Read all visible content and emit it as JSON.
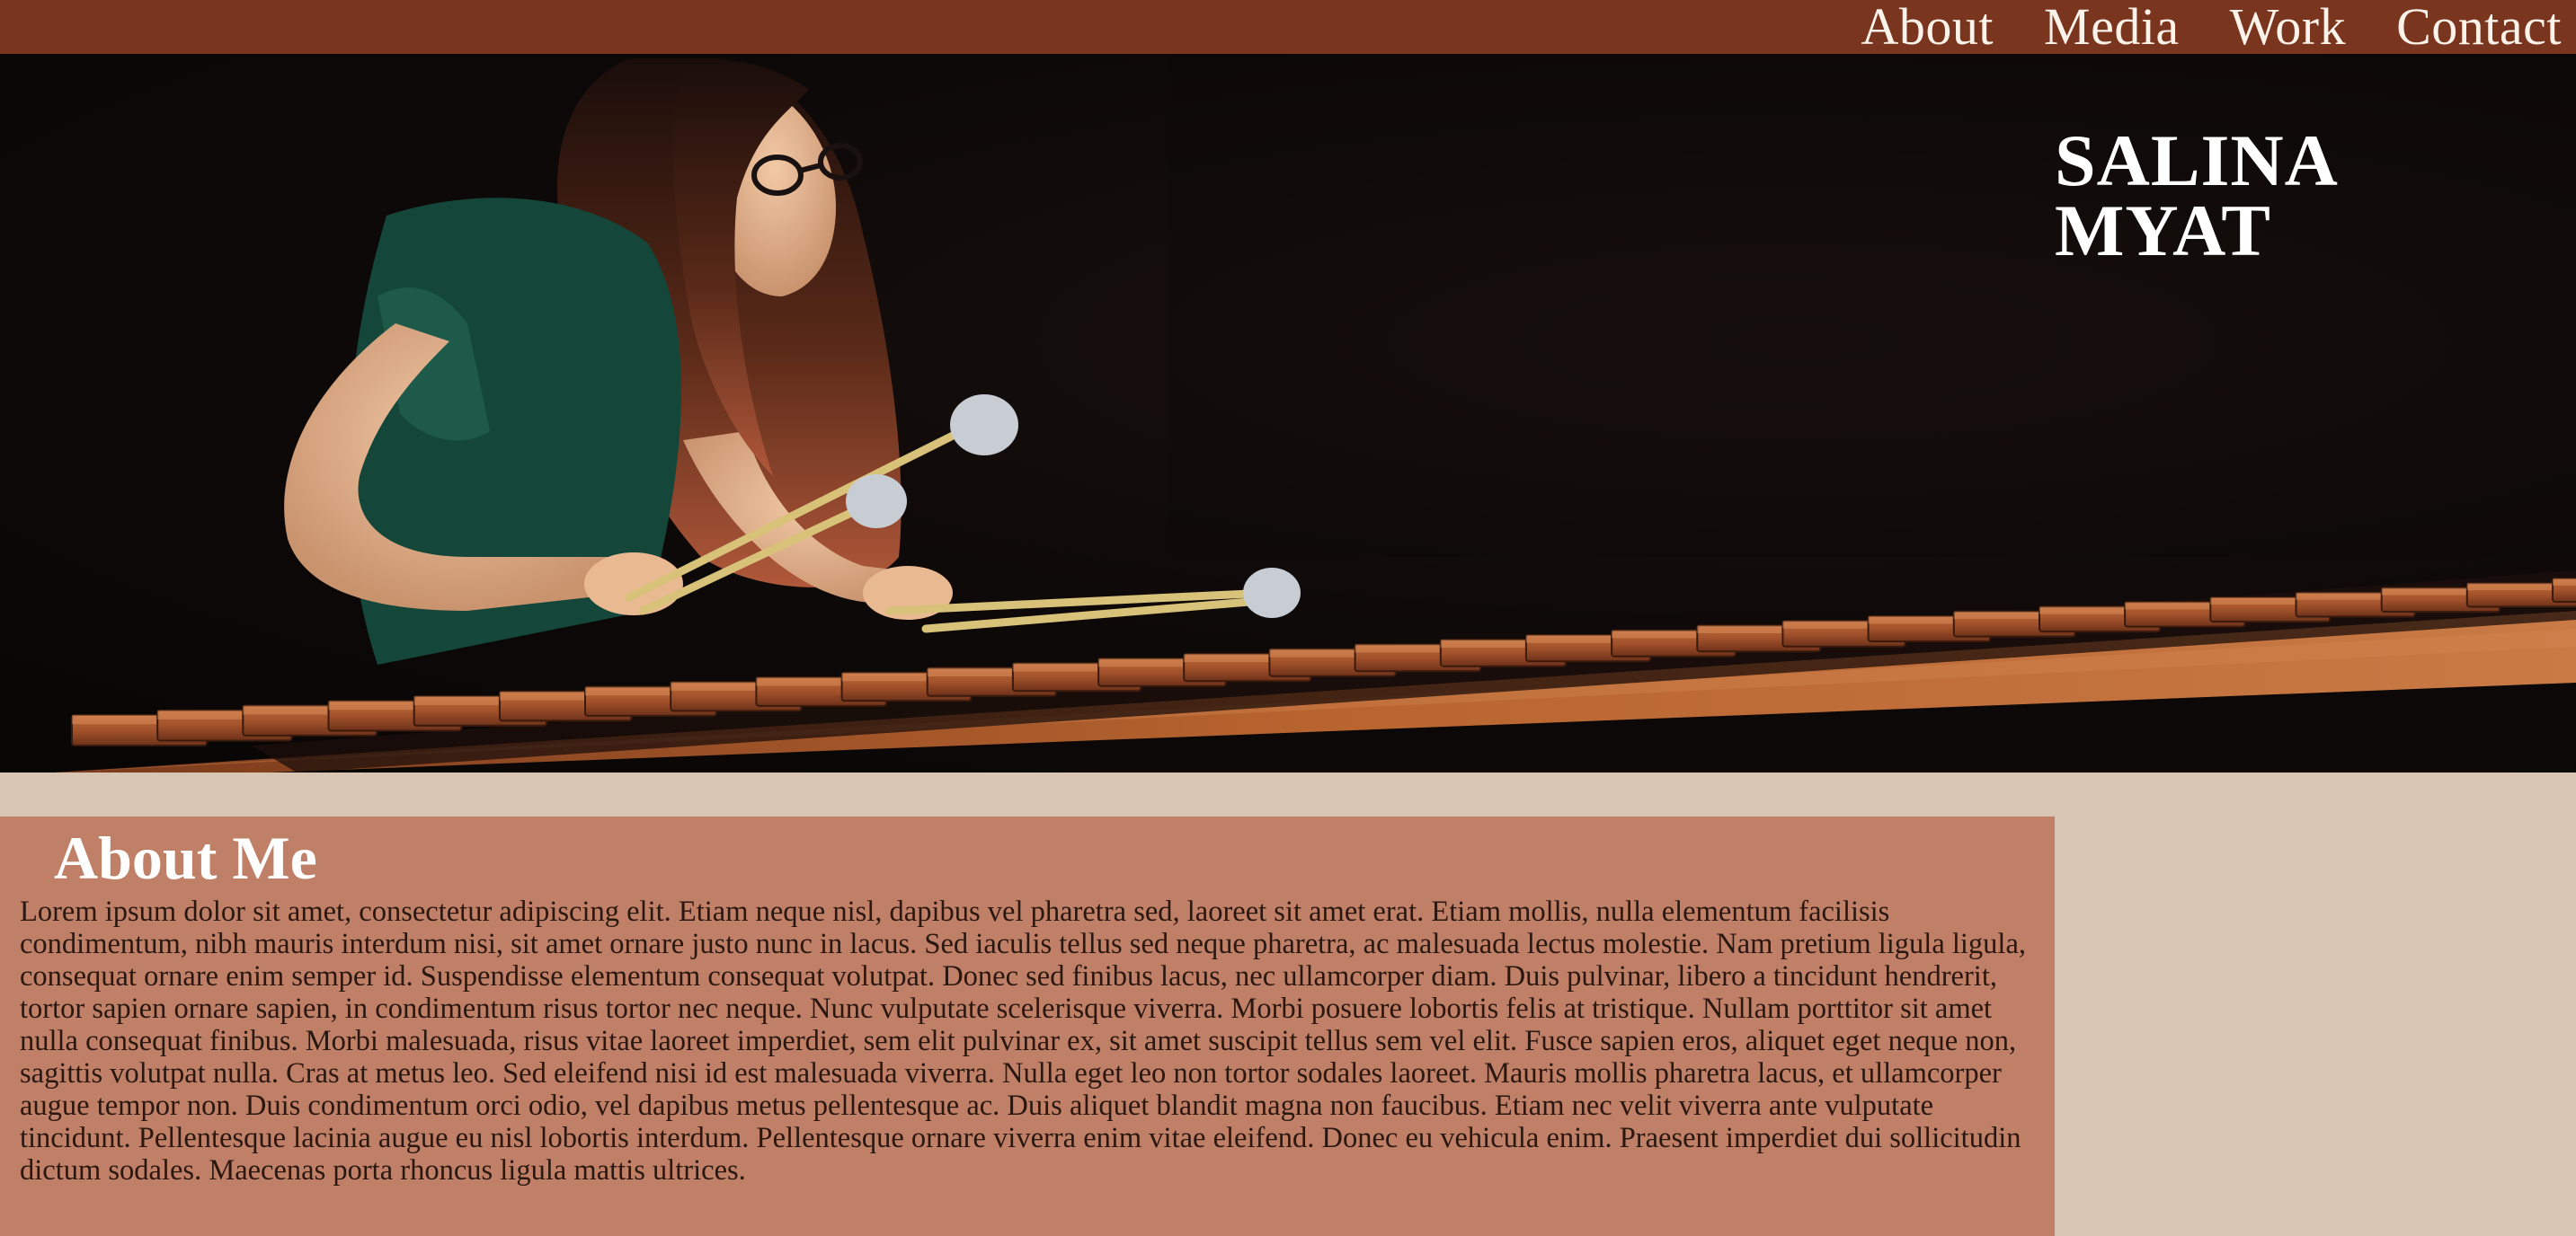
{
  "nav": {
    "items": [
      {
        "label": "About"
      },
      {
        "label": "Media"
      },
      {
        "label": "Work"
      },
      {
        "label": "Contact"
      }
    ]
  },
  "hero": {
    "name_line1": "SALINA",
    "name_line2": "MYAT",
    "image_subject": "musician playing marimba with mallets on stage"
  },
  "about": {
    "heading": "About Me",
    "body": "Lorem ipsum dolor sit amet, consectetur adipiscing elit. Etiam neque nisl, dapibus vel pharetra sed, laoreet sit amet erat. Etiam mollis, nulla elementum facilisis condimentum, nibh mauris interdum nisi, sit amet ornare justo nunc in lacus. Sed iaculis tellus sed neque pharetra, ac malesuada lectus molestie. Nam pretium ligula ligula, consequat ornare enim semper id. Suspendisse elementum consequat volutpat. Donec sed finibus lacus, nec ullamcorper diam. Duis pulvinar, libero a tincidunt hendrerit, tortor sapien ornare sapien, in condimentum risus tortor nec neque. Nunc vulputate scelerisque viverra. Morbi posuere lobortis felis at tristique. Nullam porttitor sit amet nulla consequat finibus. Morbi malesuada, risus vitae laoreet imperdiet, sem elit pulvinar ex, sit amet suscipit tellus sem vel elit. Fusce sapien eros, aliquet eget neque non, sagittis volutpat nulla. Cras at metus leo. Sed eleifend nisi id est malesuada viverra. Nulla eget leo non tortor sodales laoreet. Mauris mollis pharetra lacus, et ullamcorper augue tempor non. Duis condimentum orci odio, vel dapibus metus pellentesque ac. Duis aliquet blandit magna non faucibus. Etiam nec velit viverra ante vulputate tincidunt. Pellentesque lacinia augue eu nisl lobortis interdum. Pellentesque ornare viverra enim vitae eleifend. Donec eu vehicula enim. Praesent imperdiet dui sollicitudin dictum sodales. Maecenas porta rhoncus ligula mattis ultrices."
  },
  "colors": {
    "topbar": "#7a351e",
    "page_background": "#d8c5b3",
    "about_background": "#c08067",
    "nav_text": "#fbf3ea",
    "heading_text": "#ffffff",
    "body_text": "#2a1710"
  }
}
